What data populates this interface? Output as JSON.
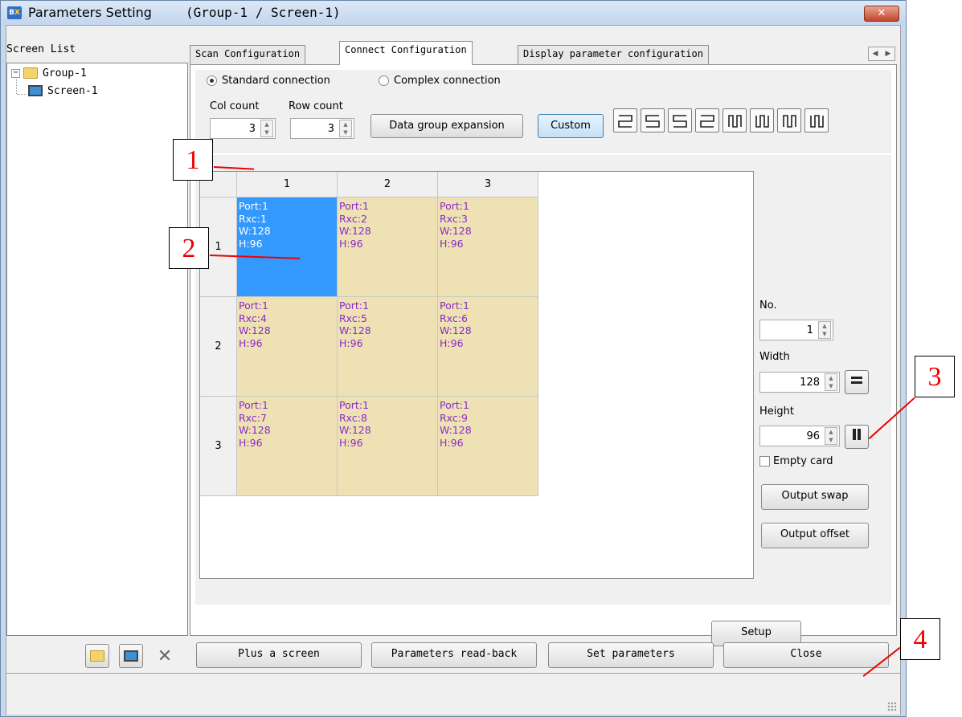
{
  "window": {
    "app_icon": "BX",
    "title": "Parameters Setting",
    "subtitle": "(Group-1 / Screen-1)",
    "close_icon": "close-icon"
  },
  "screen_list": {
    "label": "Screen List",
    "tree": [
      {
        "label": "Group-1",
        "icon": "folder-icon",
        "expander": "−"
      },
      {
        "label": "Screen-1",
        "icon": "monitor-icon"
      }
    ]
  },
  "tabs": [
    {
      "label": "Scan Configuration",
      "active": false
    },
    {
      "label": "Connect Configuration",
      "active": true
    },
    {
      "label": "Display parameter configuration",
      "active": false
    }
  ],
  "connection": {
    "standard_label": "Standard connection",
    "complex_label": "Complex connection",
    "selected": "standard"
  },
  "counts": {
    "col_label": "Col count",
    "col_value": "3",
    "row_label": "Row count",
    "row_value": "3"
  },
  "buttons": {
    "data_group_expansion": "Data group expansion",
    "custom": "Custom",
    "output_swap": "Output swap",
    "output_offset": "Output offset",
    "setup": "Setup",
    "plus_screen": "Plus a screen",
    "read_back": "Parameters read-back",
    "set_parameters": "Set parameters",
    "close": "Close"
  },
  "grid": {
    "columns": [
      "1",
      "2",
      "3"
    ],
    "rows": [
      "1",
      "2",
      "3"
    ],
    "cells": [
      [
        {
          "port": "Port:1",
          "rxc": "Rxc:1",
          "w": "W:128",
          "h": "H:96",
          "selected": true
        },
        {
          "port": "Port:1",
          "rxc": "Rxc:2",
          "w": "W:128",
          "h": "H:96"
        },
        {
          "port": "Port:1",
          "rxc": "Rxc:3",
          "w": "W:128",
          "h": "H:96"
        }
      ],
      [
        {
          "port": "Port:1",
          "rxc": "Rxc:4",
          "w": "W:128",
          "h": "H:96"
        },
        {
          "port": "Port:1",
          "rxc": "Rxc:5",
          "w": "W:128",
          "h": "H:96"
        },
        {
          "port": "Port:1",
          "rxc": "Rxc:6",
          "w": "W:128",
          "h": "H:96"
        }
      ],
      [
        {
          "port": "Port:1",
          "rxc": "Rxc:7",
          "w": "W:128",
          "h": "H:96"
        },
        {
          "port": "Port:1",
          "rxc": "Rxc:8",
          "w": "W:128",
          "h": "H:96"
        },
        {
          "port": "Port:1",
          "rxc": "Rxc:9",
          "w": "W:128",
          "h": "H:96"
        }
      ]
    ]
  },
  "side": {
    "no_label": "No.",
    "no_value": "1",
    "width_label": "Width",
    "width_value": "128",
    "width_icon": "horizontal-lines-icon",
    "height_label": "Height",
    "height_value": "96",
    "height_icon": "vertical-bars-icon",
    "empty_card_label": "Empty card",
    "empty_card_checked": false
  },
  "scan_patterns": [
    "snake-left-icon",
    "snake-right-icon",
    "snake-reverse-left-icon",
    "snake-reverse-right-icon",
    "snake-up-icon",
    "snake-down-icon",
    "snake-up-alt-icon",
    "snake-down-alt-icon"
  ],
  "bottom_icons": [
    "folder-icon",
    "monitor-icon",
    "delete-icon"
  ],
  "annotations": [
    "1",
    "2",
    "3",
    "4"
  ],
  "colors": {
    "selected_cell": "#3399ff",
    "cell_bg": "#eee1b4",
    "cell_text": "#8a2bc8",
    "annotation": "#e00000"
  }
}
